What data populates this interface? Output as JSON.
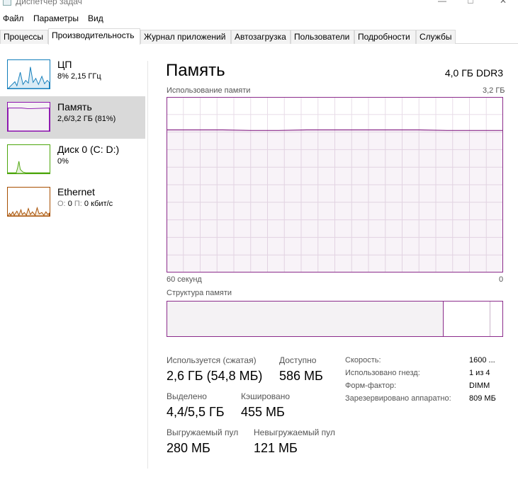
{
  "window": {
    "title": "Диспетчер задач",
    "icon": "task-manager-icon",
    "controls": [
      "minimize-icon",
      "maximize-icon",
      "close-icon"
    ]
  },
  "menu": {
    "items": [
      "Файл",
      "Параметры",
      "Вид"
    ]
  },
  "tabs": [
    {
      "label": "Процессы",
      "active": false
    },
    {
      "label": "Производительность",
      "active": true
    },
    {
      "label": "Журнал приложений",
      "active": false
    },
    {
      "label": "Автозагрузка",
      "active": false
    },
    {
      "label": "Пользователи",
      "active": false
    },
    {
      "label": "Подробности",
      "active": false
    },
    {
      "label": "Службы",
      "active": false
    }
  ],
  "sidebar": {
    "items": [
      {
        "name": "ЦП",
        "sub": "8% 2,15 ГГц",
        "color": "#117dbb",
        "active": false
      },
      {
        "name": "Память",
        "sub": "2,6/3,2 ГБ (81%)",
        "color": "#8b12ae",
        "active": true
      },
      {
        "name": "Диск 0 (C: D:)",
        "sub": "0%",
        "color": "#4da60c",
        "active": false
      },
      {
        "name": "Ethernet",
        "sub_prefix_o": "О:",
        "sub_o": "0",
        "sub_prefix_p": "П:",
        "sub_p": "0 кбит/с",
        "color": "#a74f01",
        "active": false
      }
    ]
  },
  "main": {
    "title": "Память",
    "type": "4,0 ГБ DDR3",
    "usage_label": "Использование памяти",
    "usage_max": "3,2 ГБ",
    "time_left": "60 секунд",
    "time_right": "0",
    "structure_label": "Структура памяти",
    "accent": "#8b2c8b",
    "stats": {
      "in_use_label": "Используется (сжатая)",
      "in_use_value": "2,6 ГБ (54,8 МБ)",
      "available_label": "Доступно",
      "available_value": "586 МБ",
      "committed_label": "Выделено",
      "committed_value": "4,4/5,5 ГБ",
      "cached_label": "Кэшировано",
      "cached_value": "455 МБ",
      "paged_label": "Выгружаемый пул",
      "paged_value": "280 МБ",
      "nonpaged_label": "Невыгружаемый пул",
      "nonpaged_value": "121 МБ"
    },
    "specs": {
      "speed_label": "Скорость:",
      "speed_value": "1600 ...",
      "slots_label": "Использовано гнезд:",
      "slots_value": "1 из 4",
      "form_label": "Форм-фактор:",
      "form_value": "DIMM",
      "reserved_label": "Зарезервировано аппаратно:",
      "reserved_value": "809 МБ"
    }
  },
  "chart_data": {
    "type": "line",
    "title": "Использование памяти",
    "ylim": [
      0,
      3.2
    ],
    "x": [
      60,
      55,
      50,
      45,
      40,
      35,
      30,
      25,
      20,
      15,
      10,
      5,
      0
    ],
    "series": [
      {
        "values": [
          2.6,
          2.6,
          2.6,
          2.59,
          2.59,
          2.6,
          2.6,
          2.6,
          2.6,
          2.6,
          2.59,
          2.59,
          2.59
        ]
      }
    ],
    "grid": true
  }
}
